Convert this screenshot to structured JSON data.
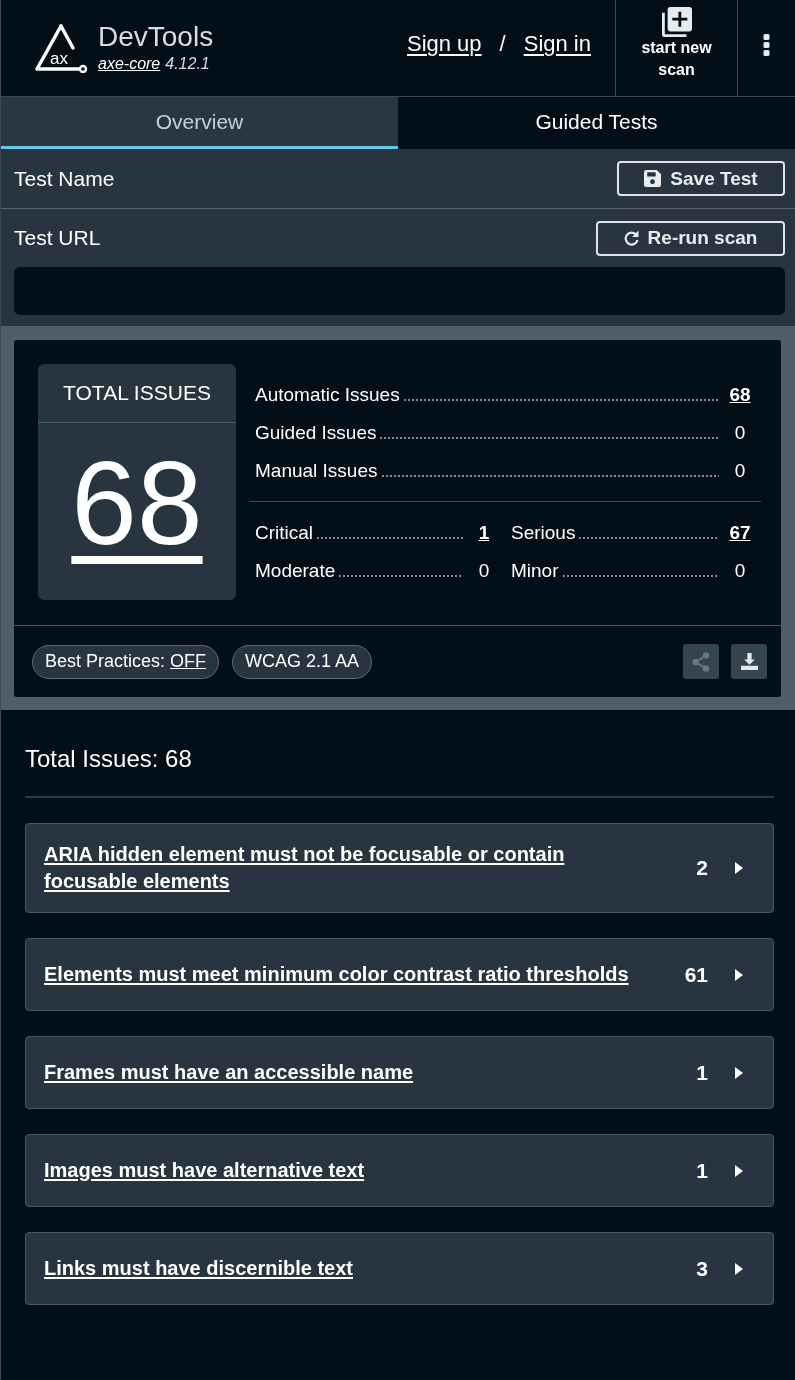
{
  "header": {
    "logo_text": "ax",
    "title": "DevTools",
    "version_link": "axe-core",
    "version": "4.12.1",
    "account_links": [
      "Sign up",
      "Sign in"
    ],
    "separator": "/",
    "new_scan": "start new scan"
  },
  "tabs": [
    {
      "label": "Overview",
      "selected": true
    },
    {
      "label": "Guided Tests",
      "selected": false
    }
  ],
  "test_name": {
    "label": "Test Name",
    "button": "Save Test"
  },
  "test_url": {
    "label": "Test URL",
    "button": "Re-run scan"
  },
  "summary": {
    "total_label": "TOTAL ISSUES",
    "total_value": "68",
    "sources": [
      {
        "label": "Automatic Issues",
        "value": "68",
        "link": true
      },
      {
        "label": "Guided Issues",
        "value": "0",
        "link": false
      },
      {
        "label": "Manual Issues",
        "value": "0",
        "link": false
      }
    ],
    "impacts": [
      {
        "label": "Critical",
        "value": "1",
        "link": true
      },
      {
        "label": "Serious",
        "value": "67",
        "link": true
      },
      {
        "label": "Moderate",
        "value": "0",
        "link": false
      },
      {
        "label": "Minor",
        "value": "0",
        "link": false
      }
    ],
    "chips": [
      {
        "kind": "toggle",
        "label": "Best Practices:",
        "value": "OFF"
      },
      {
        "kind": "plain",
        "label": "WCAG 2.1 AA"
      }
    ],
    "actions": [
      {
        "kind": "share",
        "disabled": true
      },
      {
        "kind": "download",
        "disabled": false
      }
    ]
  },
  "results": {
    "heading": "Total Issues: 68",
    "issues": [
      {
        "title": "ARIA hidden element must not be focusable or contain focusable elements",
        "count": "2"
      },
      {
        "title": "Elements must meet minimum color contrast ratio thresholds",
        "count": "61"
      },
      {
        "title": "Frames must have an accessible name",
        "count": "1"
      },
      {
        "title": "Images must have alternative text",
        "count": "1"
      },
      {
        "title": "Links must have discernible text",
        "count": "3"
      }
    ]
  }
}
